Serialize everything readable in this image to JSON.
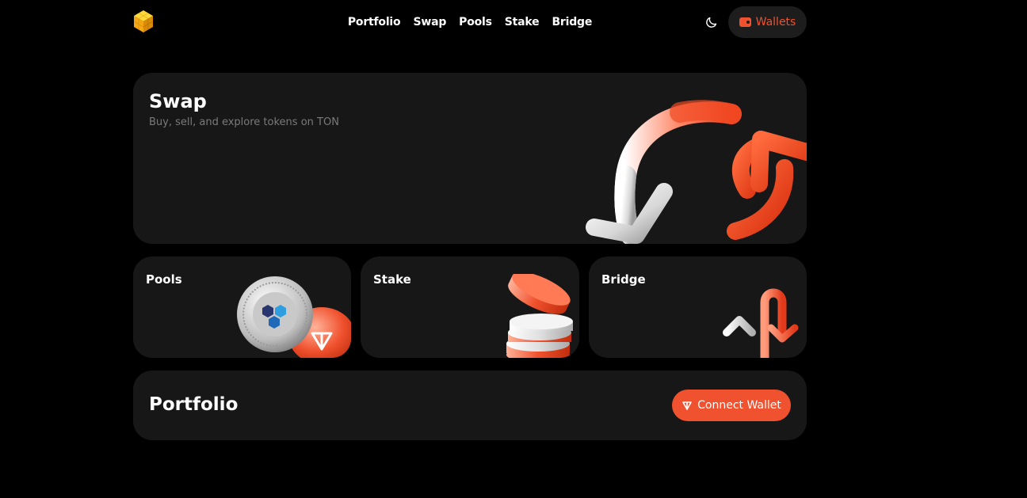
{
  "header": {
    "logo_icon": "cube-logo-icon",
    "nav": [
      "Portfolio",
      "Swap",
      "Pools",
      "Stake",
      "Bridge"
    ],
    "theme_icon": "moon-icon",
    "wallets_label": "Wallets",
    "wallets_icon": "wallet-icon"
  },
  "swap": {
    "title": "Swap",
    "subtitle": "Buy, sell, and explore tokens on TON",
    "art_icon": "swap-arrows-icon"
  },
  "cards": [
    {
      "title": "Pools",
      "art_icon": "coins-icon"
    },
    {
      "title": "Stake",
      "art_icon": "coin-stack-icon"
    },
    {
      "title": "Bridge",
      "art_icon": "up-down-arrows-icon"
    }
  ],
  "portfolio": {
    "title": "Portfolio",
    "connect_label": "Connect Wallet",
    "connect_icon": "ton-icon"
  },
  "colors": {
    "background": "#000000",
    "card": "#171717",
    "accent": "#f0512e",
    "muted_text": "#7a7a7a"
  }
}
